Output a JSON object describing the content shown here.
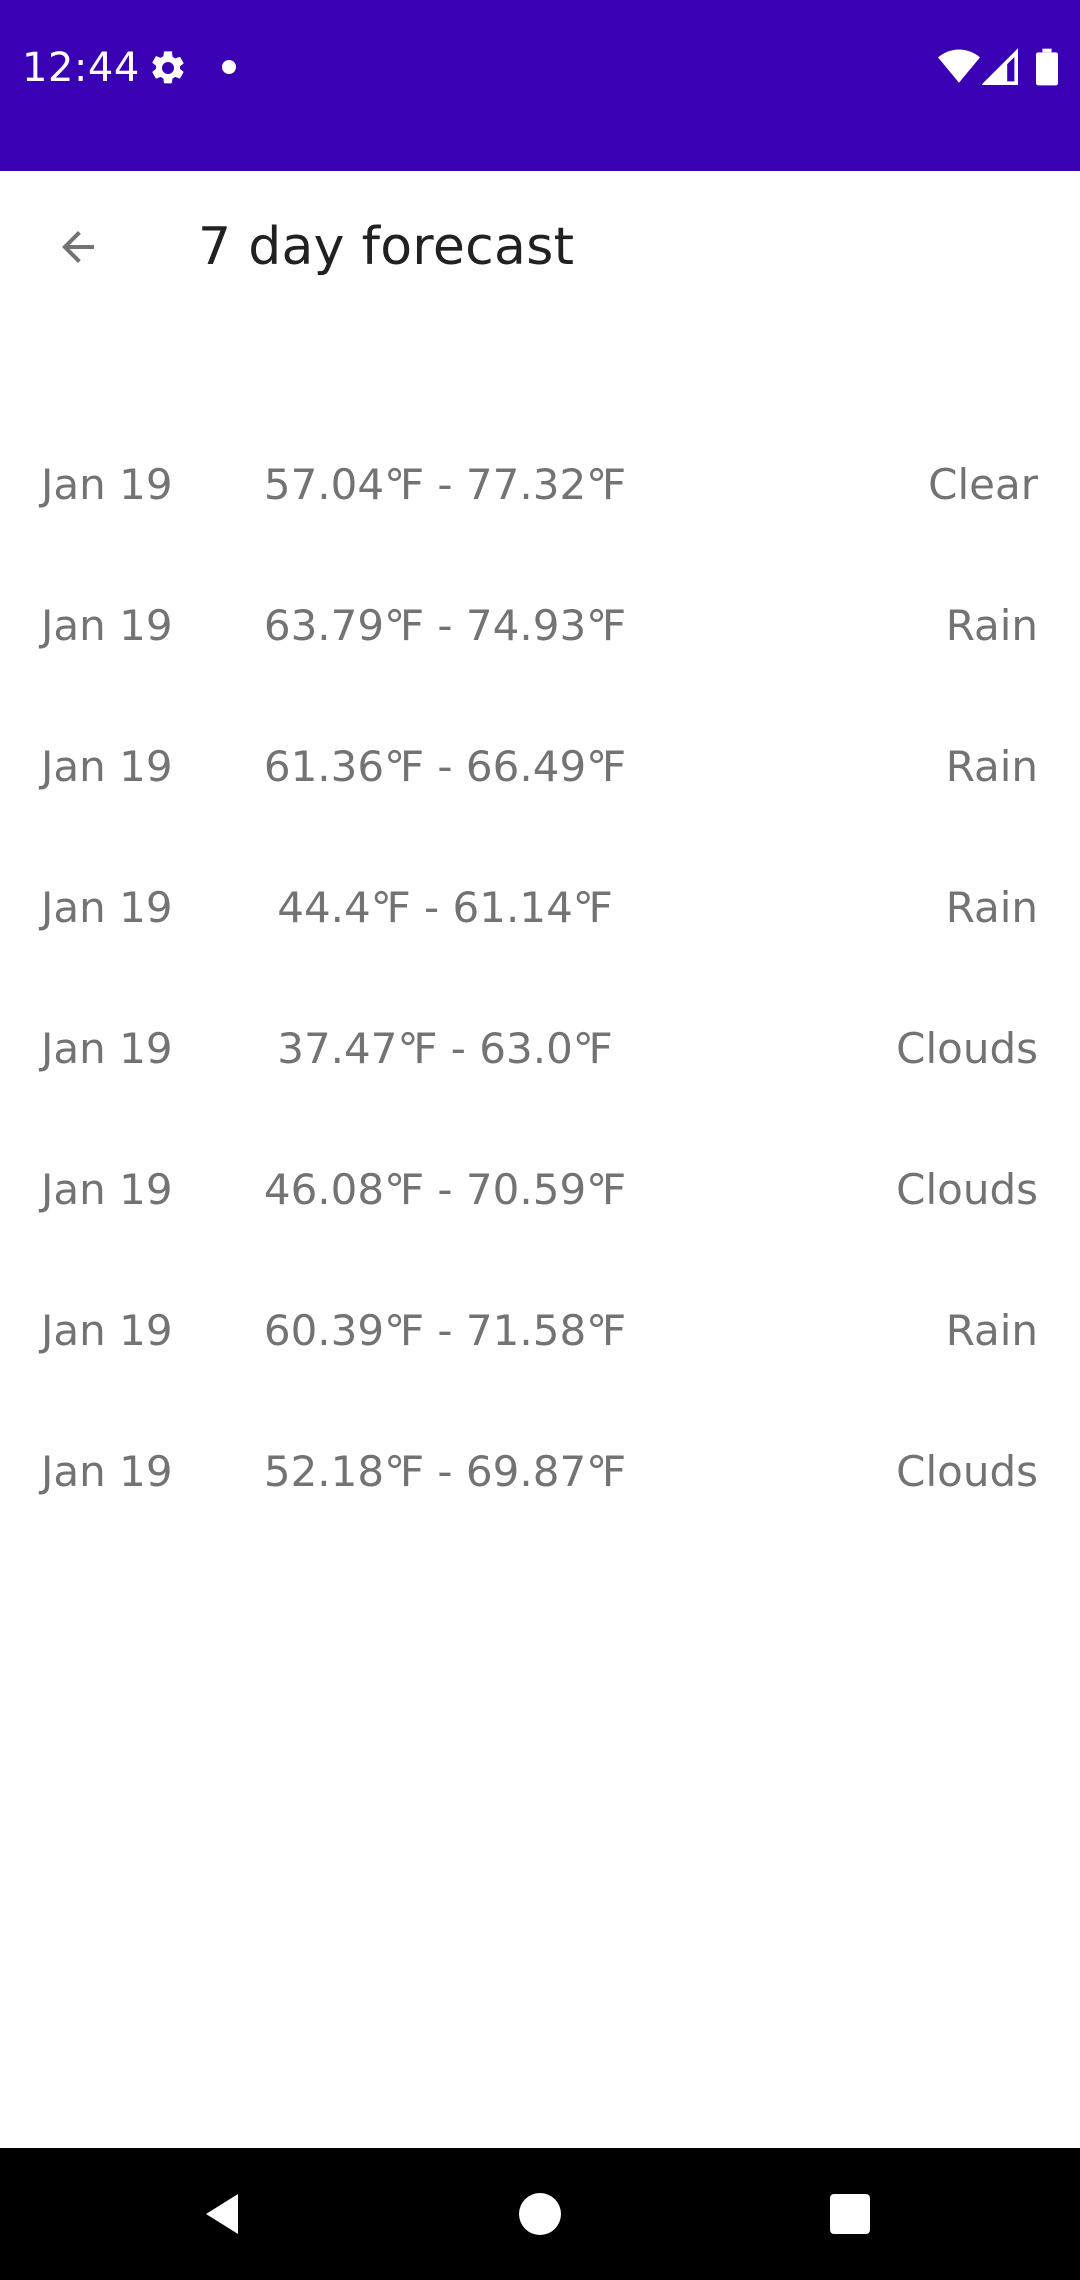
{
  "status_bar": {
    "time": "12:44",
    "icons": [
      "gear-icon",
      "notification-dot-icon",
      "wifi-icon",
      "cell-signal-icon",
      "battery-icon"
    ],
    "background_color": "#3a00b3"
  },
  "app_bar": {
    "title": "7 day forecast",
    "back_icon": "arrow-back-icon"
  },
  "forecast": [
    {
      "date": "Jan 19",
      "range": "57.04℉ - 77.32℉",
      "condition": "Clear"
    },
    {
      "date": "Jan 19",
      "range": "63.79℉ - 74.93℉",
      "condition": "Rain"
    },
    {
      "date": "Jan 19",
      "range": "61.36℉ - 66.49℉",
      "condition": "Rain"
    },
    {
      "date": "Jan 19",
      "range": "44.4℉ - 61.14℉",
      "condition": "Rain"
    },
    {
      "date": "Jan 19",
      "range": "37.47℉ - 63.0℉",
      "condition": "Clouds"
    },
    {
      "date": "Jan 19",
      "range": "46.08℉ - 70.59℉",
      "condition": "Clouds"
    },
    {
      "date": "Jan 19",
      "range": "60.39℉ - 71.58℉",
      "condition": "Rain"
    },
    {
      "date": "Jan 19",
      "range": "52.18℉ - 69.87℉",
      "condition": "Clouds"
    }
  ],
  "nav_bar": {
    "icons": [
      "nav-back-icon",
      "nav-home-icon",
      "nav-recents-icon"
    ]
  }
}
